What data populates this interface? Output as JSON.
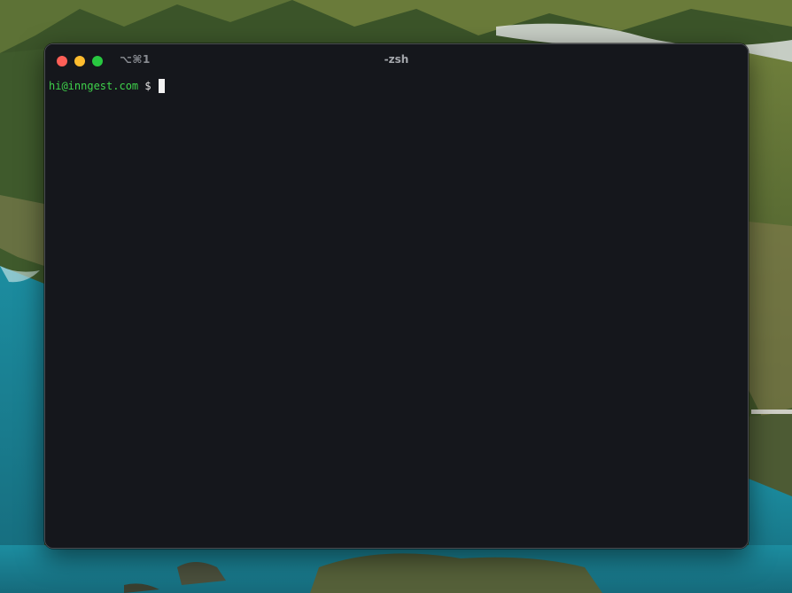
{
  "window": {
    "tab_shortcut": "⌥⌘1",
    "title": "-zsh"
  },
  "terminal": {
    "prompt_user": "hi@inngest.com",
    "prompt_symbol": " $ "
  },
  "colors": {
    "terminal_bg": "#15171c",
    "prompt_user": "#3fd34b",
    "close": "#fe5f57",
    "minimize": "#febc2e",
    "maximize": "#28c840"
  }
}
